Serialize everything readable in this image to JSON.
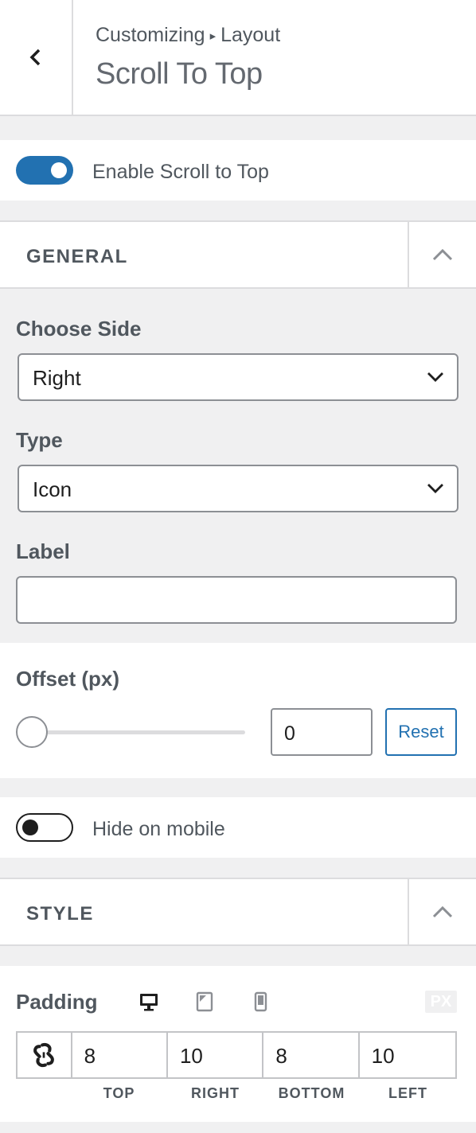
{
  "header": {
    "breadcrumb_root": "Customizing",
    "breadcrumb_sep": "▸",
    "breadcrumb_section": "Layout",
    "title": "Scroll To Top"
  },
  "enable": {
    "label": "Enable Scroll to Top",
    "checked": true
  },
  "general": {
    "title": "GENERAL",
    "choose_side": {
      "label": "Choose Side",
      "value": "Right"
    },
    "type": {
      "label": "Type",
      "value": "Icon"
    },
    "label_field": {
      "label": "Label",
      "value": ""
    }
  },
  "offset": {
    "label": "Offset (px)",
    "value": "0",
    "reset": "Reset"
  },
  "hide_mobile": {
    "label": "Hide on mobile",
    "checked": false
  },
  "style": {
    "title": "STYLE",
    "padding": {
      "label": "Padding",
      "unit": "PX",
      "values": {
        "top": "8",
        "right": "10",
        "bottom": "8",
        "left": "10"
      },
      "labels": {
        "top": "TOP",
        "right": "RIGHT",
        "bottom": "BOTTOM",
        "left": "LEFT"
      }
    }
  },
  "colors": {
    "accent": "#2271b1",
    "border": "#dcdcde",
    "text": "#50575e"
  }
}
